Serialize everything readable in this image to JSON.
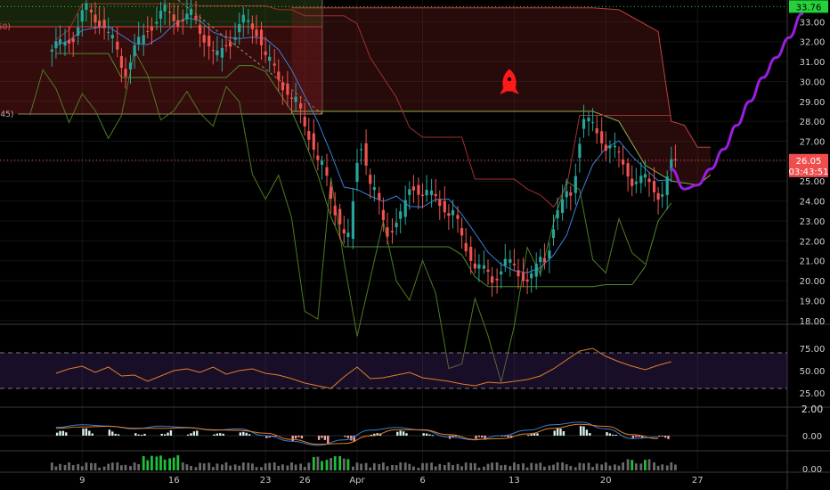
{
  "chart_data": {
    "type": "candlestick",
    "price_axis": {
      "ticks": [
        18,
        19,
        20,
        21,
        22,
        23,
        24,
        25,
        26,
        27,
        28,
        29,
        30,
        31,
        32,
        33
      ],
      "tick_labels": [
        "18.00",
        "19.00",
        "20.00",
        "21.00",
        "22.00",
        "23.00",
        "24.00",
        "25.00",
        "26.00",
        "27.00",
        "28.00",
        "29.00",
        "30.00",
        "31.00",
        "32.00",
        "33.00"
      ],
      "range": [
        17.9,
        34.0
      ]
    },
    "price_tags": {
      "top_level": {
        "value": 33.76,
        "label": "33.76",
        "color": "#25d13a"
      },
      "last_price": {
        "value": 26.05,
        "label": "26.05",
        "color": "#f04e4e"
      },
      "countdown": "03:43:51"
    },
    "left_partial_labels": [
      ".50)",
      "(.45)"
    ],
    "time_axis": {
      "labels": [
        {
          "day": 9,
          "text": "9"
        },
        {
          "day": 16,
          "text": "16"
        },
        {
          "day": 23,
          "text": "23"
        },
        {
          "day": 26,
          "text": "26"
        },
        {
          "day": 30,
          "text": "Apr"
        },
        {
          "day": 35,
          "text": "6"
        },
        {
          "day": 42,
          "text": "13"
        },
        {
          "day": 49,
          "text": "20"
        },
        {
          "day": 56,
          "text": "27"
        }
      ]
    },
    "closes": [
      [
        1,
        31.8
      ],
      [
        2,
        32.3
      ],
      [
        3,
        33.6
      ],
      [
        4,
        33.1
      ],
      [
        5,
        32.0
      ],
      [
        6,
        30.6
      ],
      [
        7,
        31.9
      ],
      [
        8,
        32.9
      ],
      [
        9,
        33.5
      ],
      [
        10,
        33.1
      ],
      [
        11,
        33.3
      ],
      [
        12,
        32.3
      ],
      [
        13,
        31.2
      ],
      [
        14,
        32.1
      ],
      [
        15,
        33.0
      ],
      [
        16,
        32.6
      ],
      [
        17,
        30.9
      ],
      [
        18,
        29.9
      ],
      [
        19,
        28.9
      ],
      [
        20,
        27.4
      ],
      [
        21,
        25.7
      ],
      [
        22,
        23.6
      ],
      [
        23,
        22.1
      ],
      [
        24,
        26.9
      ],
      [
        25,
        24.4
      ],
      [
        26,
        22.5
      ],
      [
        27,
        23.2
      ],
      [
        28,
        24.8
      ],
      [
        29,
        24.3
      ],
      [
        30,
        24.0
      ],
      [
        31,
        23.3
      ],
      [
        32,
        21.7
      ],
      [
        33,
        20.6
      ],
      [
        34,
        20.1
      ],
      [
        35,
        20.9
      ],
      [
        36,
        20.4
      ],
      [
        37,
        20.2
      ],
      [
        38,
        21.1
      ],
      [
        39,
        23.4
      ],
      [
        40,
        24.4
      ],
      [
        41,
        28.0
      ],
      [
        42,
        27.5
      ],
      [
        43,
        26.7
      ],
      [
        44,
        25.9
      ],
      [
        45,
        24.9
      ],
      [
        46,
        25.0
      ],
      [
        47,
        24.3
      ],
      [
        48,
        26.1
      ]
    ],
    "cloud_band": {
      "upper": [
        [
          1,
          33.7
        ],
        [
          24,
          33.7
        ],
        [
          26,
          33.6
        ],
        [
          29,
          32.5
        ],
        [
          30,
          28.0
        ],
        [
          31,
          27.8
        ],
        [
          32,
          26.7
        ],
        [
          33,
          26.7
        ]
      ],
      "lower": [
        [
          1,
          28.5
        ],
        [
          24,
          28.5
        ],
        [
          26,
          28.0
        ],
        [
          28,
          25.8
        ],
        [
          30,
          25.0
        ],
        [
          32,
          24.8
        ],
        [
          33,
          25.3
        ]
      ]
    },
    "projection": [
      [
        48,
        25.6
      ],
      [
        49,
        24.6
      ],
      [
        50,
        24.8
      ],
      [
        51,
        25.6
      ],
      [
        52,
        26.6
      ],
      [
        53,
        27.8
      ],
      [
        54,
        29.0
      ],
      [
        55,
        30.2
      ],
      [
        56,
        31.2
      ],
      [
        57,
        32.2
      ],
      [
        58,
        33.4
      ]
    ],
    "rsi": {
      "ticks": [
        "75.00",
        "50.00",
        "25.00"
      ],
      "levels": [
        70,
        30
      ],
      "values": [
        [
          1,
          47
        ],
        [
          2,
          52
        ],
        [
          3,
          55
        ],
        [
          4,
          48
        ],
        [
          5,
          54
        ],
        [
          6,
          44
        ],
        [
          7,
          45
        ],
        [
          8,
          38
        ],
        [
          9,
          44
        ],
        [
          10,
          50
        ],
        [
          11,
          52
        ],
        [
          12,
          48
        ],
        [
          13,
          54
        ],
        [
          14,
          46
        ],
        [
          15,
          50
        ],
        [
          16,
          52
        ],
        [
          17,
          47
        ],
        [
          18,
          45
        ],
        [
          19,
          41
        ],
        [
          20,
          36
        ],
        [
          21,
          33
        ],
        [
          22,
          30
        ],
        [
          23,
          43
        ],
        [
          24,
          54
        ],
        [
          25,
          41
        ],
        [
          26,
          42
        ],
        [
          27,
          45
        ],
        [
          28,
          48
        ],
        [
          29,
          42
        ],
        [
          30,
          40
        ],
        [
          31,
          38
        ],
        [
          32,
          35
        ],
        [
          33,
          33
        ],
        [
          34,
          37
        ],
        [
          35,
          36
        ],
        [
          36,
          38
        ],
        [
          37,
          40
        ],
        [
          38,
          44
        ],
        [
          39,
          52
        ],
        [
          40,
          62
        ],
        [
          41,
          72
        ],
        [
          42,
          75
        ],
        [
          43,
          66
        ],
        [
          44,
          60
        ],
        [
          45,
          55
        ],
        [
          46,
          51
        ],
        [
          47,
          56
        ],
        [
          48,
          60
        ]
      ]
    },
    "macd": {
      "ticks": [
        "2.00",
        "0.00"
      ],
      "histogram": [
        [
          1,
          0.4
        ],
        [
          3,
          0.6
        ],
        [
          5,
          0.5
        ],
        [
          7,
          0.3
        ],
        [
          9,
          0.5
        ],
        [
          11,
          0.4
        ],
        [
          13,
          0.2
        ],
        [
          15,
          0.3
        ],
        [
          17,
          -0.2
        ],
        [
          19,
          -0.6
        ],
        [
          21,
          -0.9
        ],
        [
          23,
          -0.5
        ],
        [
          25,
          0.2
        ],
        [
          27,
          0.4
        ],
        [
          29,
          0.2
        ],
        [
          31,
          -0.3
        ],
        [
          33,
          -0.5
        ],
        [
          35,
          -0.2
        ],
        [
          37,
          0.2
        ],
        [
          39,
          0.6
        ],
        [
          41,
          0.8
        ],
        [
          43,
          0.3
        ],
        [
          45,
          -0.4
        ],
        [
          47,
          -0.3
        ]
      ]
    },
    "volume": {
      "ticks": [
        "0.00"
      ]
    }
  }
}
